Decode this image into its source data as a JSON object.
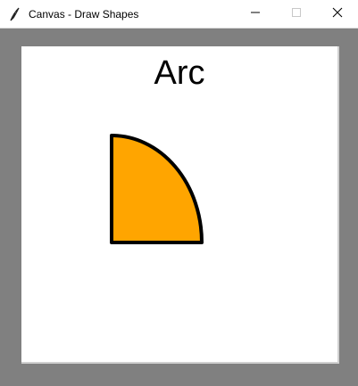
{
  "window": {
    "title": "Canvas - Draw Shapes"
  },
  "titlebar": {
    "icon": "feather-icon",
    "minimize_icon": "minimize-icon",
    "maximize_icon": "maximize-icon",
    "close_icon": "close-icon"
  },
  "canvas": {
    "shape_title": "Arc",
    "background_color": "#ffffff",
    "arc": {
      "shape": "quarter-circle pie slice",
      "fill_color": "#ffa500",
      "outline_color": "#000000"
    }
  },
  "colors": {
    "window_background": "#808080",
    "titlebar_background": "#ffffff"
  }
}
